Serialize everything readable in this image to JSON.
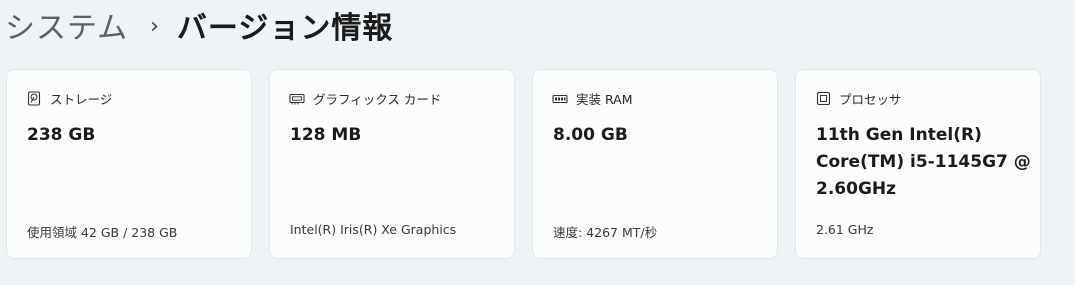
{
  "breadcrumb": {
    "parent": "システム",
    "separator": "›",
    "current": "バージョン情報"
  },
  "cards": [
    {
      "icon": "storage-icon",
      "title": "ストレージ",
      "value": "238 GB",
      "detail": "使用領域 42 GB / 238 GB"
    },
    {
      "icon": "graphics-card-icon",
      "title": "グラフィックス カード",
      "value": "128 MB",
      "detail": "Intel(R) Iris(R) Xe Graphics"
    },
    {
      "icon": "memory-icon",
      "title": "実装 RAM",
      "value": "8.00 GB",
      "detail": "速度: 4267 MT/秒"
    },
    {
      "icon": "processor-icon",
      "title": "プロセッサ",
      "value": "11th Gen Intel(R)\nCore(TM) i5-1145G7 @\n2.60GHz",
      "detail": "2.61 GHz"
    }
  ]
}
